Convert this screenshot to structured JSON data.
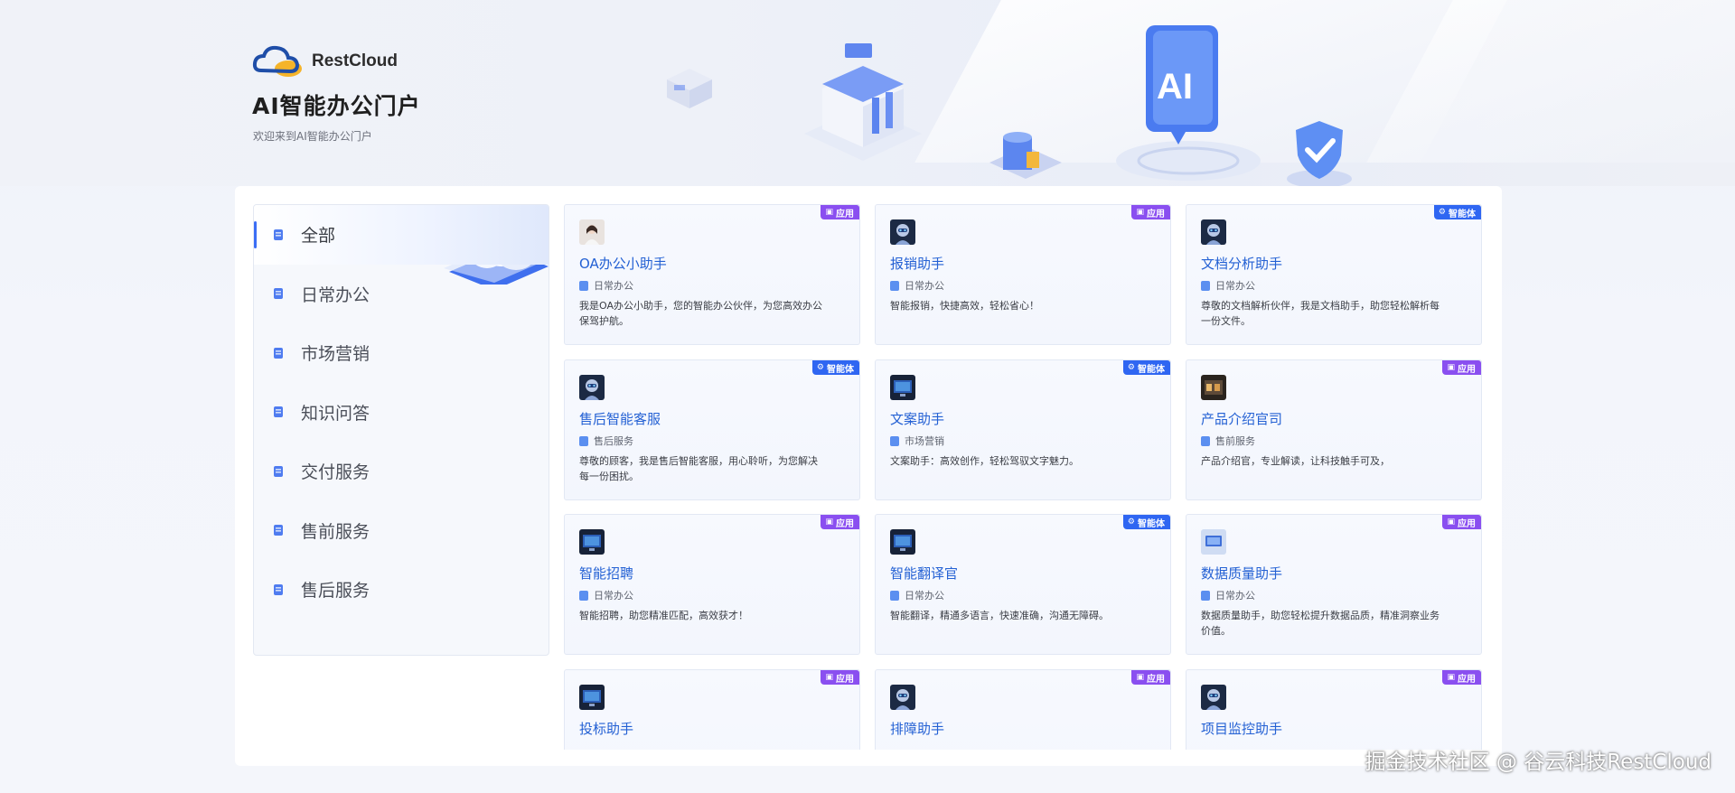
{
  "header": {
    "brand": "RestCloud",
    "title": "AI智能办公门户",
    "subtitle": "欢迎来到AI智能办公门户"
  },
  "illustration": {
    "badge_text": "AI"
  },
  "colors": {
    "accent": "#3b6ef5",
    "title_link": "#2461d4",
    "badge_app": "#8a4ff0",
    "badge_agent": "#2f66f2"
  },
  "sidebar": {
    "items": [
      {
        "label": "全部",
        "icon": "grid-icon",
        "active": true
      },
      {
        "label": "日常办公",
        "icon": "calendar-icon",
        "active": false
      },
      {
        "label": "市场营销",
        "icon": "marketing-icon",
        "active": false
      },
      {
        "label": "知识问答",
        "icon": "book-icon",
        "active": false
      },
      {
        "label": "交付服务",
        "icon": "delivery-icon",
        "active": false
      },
      {
        "label": "售前服务",
        "icon": "presales-icon",
        "active": false
      },
      {
        "label": "售后服务",
        "icon": "aftersales-icon",
        "active": false
      }
    ]
  },
  "badges": {
    "app": "应用",
    "agent": "智能体"
  },
  "cards": [
    {
      "title": "OA办公小助手",
      "category": "日常办公",
      "desc": "我是OA办公小助手，您的智能办公伙伴，为您高效办公保驾护航。",
      "badge": "app",
      "avatar": "woman-avatar"
    },
    {
      "title": "报销助手",
      "category": "日常办公",
      "desc": "智能报销，快捷高效，轻松省心！",
      "badge": "app",
      "avatar": "robot-avatar"
    },
    {
      "title": "文档分析助手",
      "category": "日常办公",
      "desc": "尊敬的文档解析伙伴，我是文档助手，助您轻松解析每一份文件。",
      "badge": "agent",
      "avatar": "robot-avatar"
    },
    {
      "title": "售后智能客服",
      "category": "售后服务",
      "desc": "尊敬的顾客，我是售后智能客服，用心聆听，为您解决每一份困扰。",
      "badge": "agent",
      "avatar": "robot-avatar"
    },
    {
      "title": "文案助手",
      "category": "市场营销",
      "desc": "文案助手：高效创作，轻松驾驭文字魅力。",
      "badge": "agent",
      "avatar": "screen-avatar"
    },
    {
      "title": "产品介绍官司",
      "category": "售前服务",
      "desc": "产品介绍官，专业解读，让科技触手可及，",
      "badge": "app",
      "avatar": "shop-avatar"
    },
    {
      "title": "智能招聘",
      "category": "日常办公",
      "desc": "智能招聘，助您精准匹配，高效获才！",
      "badge": "app",
      "avatar": "screen-avatar"
    },
    {
      "title": "智能翻译官",
      "category": "日常办公",
      "desc": "智能翻译，精通多语言，快速准确，沟通无障碍。",
      "badge": "agent",
      "avatar": "screen-avatar"
    },
    {
      "title": "数据质量助手",
      "category": "日常办公",
      "desc": "数据质量助手，助您轻松提升数据品质，精准洞察业务价值。",
      "badge": "app",
      "avatar": "monitor-avatar"
    },
    {
      "title": "投标助手",
      "category": "",
      "desc": "",
      "badge": "app",
      "avatar": "screen-avatar"
    },
    {
      "title": "排障助手",
      "category": "",
      "desc": "",
      "badge": "app",
      "avatar": "robot-avatar"
    },
    {
      "title": "项目监控助手",
      "category": "",
      "desc": "",
      "badge": "app",
      "avatar": "robot-avatar"
    }
  ],
  "watermark": "掘金技术社区 @ 谷云科技RestCloud"
}
